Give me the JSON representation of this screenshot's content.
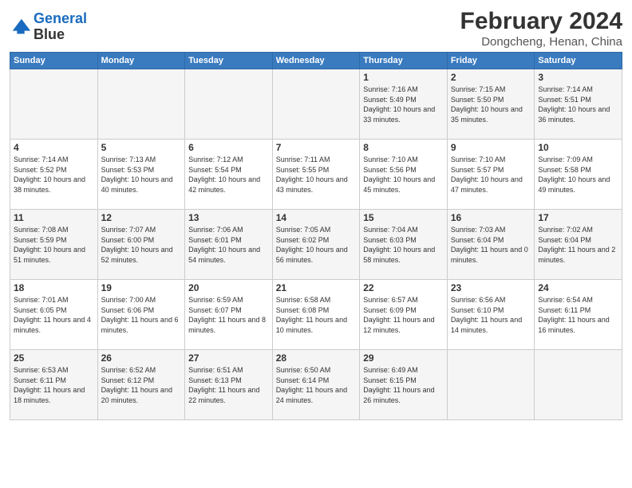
{
  "header": {
    "logo_line1": "General",
    "logo_line2": "Blue",
    "title": "February 2024",
    "subtitle": "Dongcheng, Henan, China"
  },
  "days_of_week": [
    "Sunday",
    "Monday",
    "Tuesday",
    "Wednesday",
    "Thursday",
    "Friday",
    "Saturday"
  ],
  "weeks": [
    [
      {
        "day": "",
        "info": ""
      },
      {
        "day": "",
        "info": ""
      },
      {
        "day": "",
        "info": ""
      },
      {
        "day": "",
        "info": ""
      },
      {
        "day": "1",
        "info": "Sunrise: 7:16 AM\nSunset: 5:49 PM\nDaylight: 10 hours\nand 33 minutes."
      },
      {
        "day": "2",
        "info": "Sunrise: 7:15 AM\nSunset: 5:50 PM\nDaylight: 10 hours\nand 35 minutes."
      },
      {
        "day": "3",
        "info": "Sunrise: 7:14 AM\nSunset: 5:51 PM\nDaylight: 10 hours\nand 36 minutes."
      }
    ],
    [
      {
        "day": "4",
        "info": "Sunrise: 7:14 AM\nSunset: 5:52 PM\nDaylight: 10 hours\nand 38 minutes."
      },
      {
        "day": "5",
        "info": "Sunrise: 7:13 AM\nSunset: 5:53 PM\nDaylight: 10 hours\nand 40 minutes."
      },
      {
        "day": "6",
        "info": "Sunrise: 7:12 AM\nSunset: 5:54 PM\nDaylight: 10 hours\nand 42 minutes."
      },
      {
        "day": "7",
        "info": "Sunrise: 7:11 AM\nSunset: 5:55 PM\nDaylight: 10 hours\nand 43 minutes."
      },
      {
        "day": "8",
        "info": "Sunrise: 7:10 AM\nSunset: 5:56 PM\nDaylight: 10 hours\nand 45 minutes."
      },
      {
        "day": "9",
        "info": "Sunrise: 7:10 AM\nSunset: 5:57 PM\nDaylight: 10 hours\nand 47 minutes."
      },
      {
        "day": "10",
        "info": "Sunrise: 7:09 AM\nSunset: 5:58 PM\nDaylight: 10 hours\nand 49 minutes."
      }
    ],
    [
      {
        "day": "11",
        "info": "Sunrise: 7:08 AM\nSunset: 5:59 PM\nDaylight: 10 hours\nand 51 minutes."
      },
      {
        "day": "12",
        "info": "Sunrise: 7:07 AM\nSunset: 6:00 PM\nDaylight: 10 hours\nand 52 minutes."
      },
      {
        "day": "13",
        "info": "Sunrise: 7:06 AM\nSunset: 6:01 PM\nDaylight: 10 hours\nand 54 minutes."
      },
      {
        "day": "14",
        "info": "Sunrise: 7:05 AM\nSunset: 6:02 PM\nDaylight: 10 hours\nand 56 minutes."
      },
      {
        "day": "15",
        "info": "Sunrise: 7:04 AM\nSunset: 6:03 PM\nDaylight: 10 hours\nand 58 minutes."
      },
      {
        "day": "16",
        "info": "Sunrise: 7:03 AM\nSunset: 6:04 PM\nDaylight: 11 hours\nand 0 minutes."
      },
      {
        "day": "17",
        "info": "Sunrise: 7:02 AM\nSunset: 6:04 PM\nDaylight: 11 hours\nand 2 minutes."
      }
    ],
    [
      {
        "day": "18",
        "info": "Sunrise: 7:01 AM\nSunset: 6:05 PM\nDaylight: 11 hours\nand 4 minutes."
      },
      {
        "day": "19",
        "info": "Sunrise: 7:00 AM\nSunset: 6:06 PM\nDaylight: 11 hours\nand 6 minutes."
      },
      {
        "day": "20",
        "info": "Sunrise: 6:59 AM\nSunset: 6:07 PM\nDaylight: 11 hours\nand 8 minutes."
      },
      {
        "day": "21",
        "info": "Sunrise: 6:58 AM\nSunset: 6:08 PM\nDaylight: 11 hours\nand 10 minutes."
      },
      {
        "day": "22",
        "info": "Sunrise: 6:57 AM\nSunset: 6:09 PM\nDaylight: 11 hours\nand 12 minutes."
      },
      {
        "day": "23",
        "info": "Sunrise: 6:56 AM\nSunset: 6:10 PM\nDaylight: 11 hours\nand 14 minutes."
      },
      {
        "day": "24",
        "info": "Sunrise: 6:54 AM\nSunset: 6:11 PM\nDaylight: 11 hours\nand 16 minutes."
      }
    ],
    [
      {
        "day": "25",
        "info": "Sunrise: 6:53 AM\nSunset: 6:11 PM\nDaylight: 11 hours\nand 18 minutes."
      },
      {
        "day": "26",
        "info": "Sunrise: 6:52 AM\nSunset: 6:12 PM\nDaylight: 11 hours\nand 20 minutes."
      },
      {
        "day": "27",
        "info": "Sunrise: 6:51 AM\nSunset: 6:13 PM\nDaylight: 11 hours\nand 22 minutes."
      },
      {
        "day": "28",
        "info": "Sunrise: 6:50 AM\nSunset: 6:14 PM\nDaylight: 11 hours\nand 24 minutes."
      },
      {
        "day": "29",
        "info": "Sunrise: 6:49 AM\nSunset: 6:15 PM\nDaylight: 11 hours\nand 26 minutes."
      },
      {
        "day": "",
        "info": ""
      },
      {
        "day": "",
        "info": ""
      }
    ]
  ]
}
